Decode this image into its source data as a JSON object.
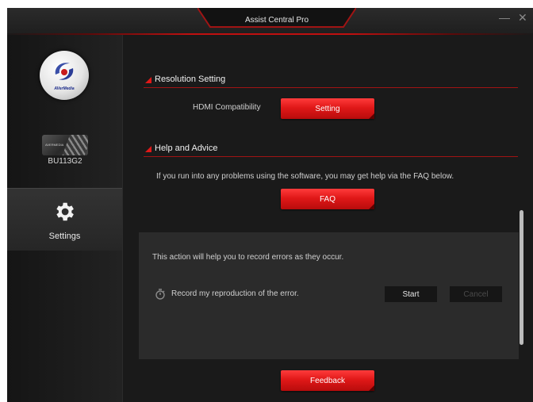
{
  "window": {
    "title": "Assist Central Pro",
    "minimize_glyph": "—",
    "close_glyph": "✕"
  },
  "sidebar": {
    "logo_text": "AVerMedia",
    "device": {
      "label": "BU113G2",
      "tag": "AVERMEDIA"
    },
    "settings": {
      "label": "Settings",
      "icon": "gear-icon"
    }
  },
  "resolution": {
    "heading": "Resolution Setting",
    "hdmi_label": "HDMI Compatibility",
    "setting_button": "Setting"
  },
  "help": {
    "heading": "Help and Advice",
    "description": "If you run into any problems using the software, you may get help via the FAQ below.",
    "faq_button": "FAQ"
  },
  "record": {
    "info": "This action will help you to record errors as they occur.",
    "label": "Record my reproduction of the error.",
    "start_button": "Start",
    "cancel_button": "Cancel"
  },
  "feedback_button": "Feedback",
  "colors": {
    "accent_red": "#e01818",
    "background": "#1a1a1a",
    "panel": "#2b2b2b"
  }
}
